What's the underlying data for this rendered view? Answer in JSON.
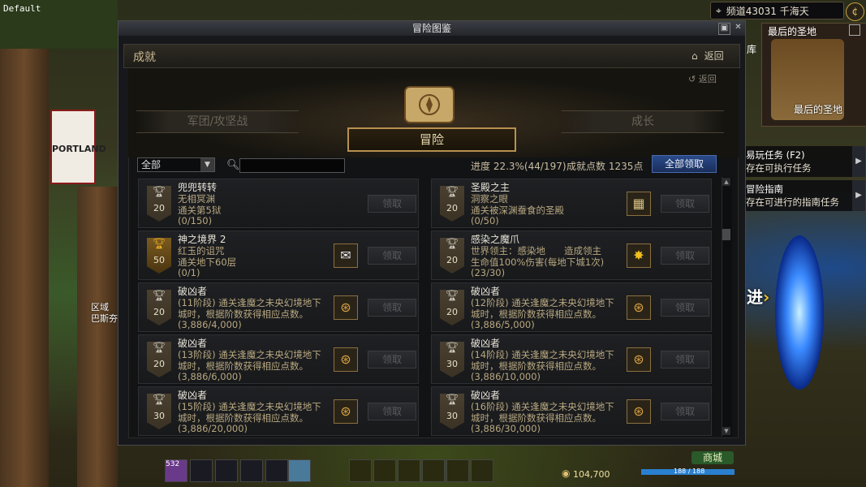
{
  "hud_top": {
    "default_label": "Default",
    "channel": "频道43031 千海天",
    "coin_icon": "coin-icon"
  },
  "minimap": {
    "title": "最后的圣地",
    "label": "最后的圣地"
  },
  "quests": [
    {
      "title": "易玩任务 (F2)",
      "subtitle": "存在可执行任务"
    },
    {
      "title": "冒险指南",
      "subtitle": "存在可进行的指南任务"
    }
  ],
  "world": {
    "portal_text": "进",
    "npc_line1": "区域",
    "npc_line2": "巴斯夯",
    "portland_sign": "PORTLAND",
    "sign_partial": "库"
  },
  "window": {
    "title": "冒险图鉴",
    "header_title": "成就",
    "back_label": "返回",
    "back_small": "返回",
    "categories": {
      "left": "军团/攻坚战",
      "center": "冒险",
      "right": "成长"
    },
    "filter": {
      "selected": "全部"
    },
    "search": {
      "placeholder": ""
    },
    "progress_text": "进度 22.3%(44/197)",
    "points_text": "成就点数 1235点",
    "claim_all_label": "全部领取",
    "claim_label": "领取"
  },
  "achievements": [
    {
      "name": "兜兜转转",
      "lines": [
        "无相冥渊",
        "通关第5狱"
      ],
      "progress": "(0/150)",
      "points": "20",
      "gold": false,
      "icon": ""
    },
    {
      "name": "圣殿之主",
      "lines": [
        "洞察之眼",
        "通关被深渊蚕食的圣殿"
      ],
      "progress": "(0/50)",
      "points": "20",
      "gold": false,
      "icon": "map-icon"
    },
    {
      "name": "神之境界 2",
      "lines": [
        "红玉的诅咒",
        "通关地下60层"
      ],
      "progress": "(0/1)",
      "points": "50",
      "gold": true,
      "icon": "scroll-note-icon"
    },
    {
      "name": "感染之魔爪",
      "lines": [
        "世界领主：感染地　　造成领主",
        "生命值100%伤害(每地下城1次)"
      ],
      "progress": "(23/30)",
      "points": "20",
      "gold": false,
      "icon": "burst-icon"
    },
    {
      "name": "破凶者",
      "lines": [
        "(11阶段) 通关逢魔之未央幻境地下",
        "城时，根据阶数获得相应点数。"
      ],
      "progress": "(3,886/4,000)",
      "points": "20",
      "gold": false,
      "icon": "emblem-icon"
    },
    {
      "name": "破凶者",
      "lines": [
        "(12阶段) 通关逢魔之未央幻境地下",
        "城时，根据阶数获得相应点数。"
      ],
      "progress": "(3,886/5,000)",
      "points": "20",
      "gold": false,
      "icon": "emblem-icon"
    },
    {
      "name": "破凶者",
      "lines": [
        "(13阶段) 通关逢魔之未央幻境地下",
        "城时，根据阶数获得相应点数。"
      ],
      "progress": "(3,886/6,000)",
      "points": "20",
      "gold": false,
      "icon": "emblem-icon"
    },
    {
      "name": "破凶者",
      "lines": [
        "(14阶段) 通关逢魔之未央幻境地下",
        "城时，根据阶数获得相应点数。"
      ],
      "progress": "(3,886/10,000)",
      "points": "30",
      "gold": false,
      "icon": "emblem-icon"
    },
    {
      "name": "破凶者",
      "lines": [
        "(15阶段) 通关逢魔之未央幻境地下",
        "城时，根据阶数获得相应点数。"
      ],
      "progress": "(3,886/20,000)",
      "points": "30",
      "gold": false,
      "icon": "emblem-icon"
    },
    {
      "name": "破凶者",
      "lines": [
        "(16阶段) 通关逢魔之未央幻境地下",
        "城时，根据阶数获得相应点数。"
      ],
      "progress": "(3,886/30,000)",
      "points": "30",
      "gold": false,
      "icon": "emblem-icon"
    }
  ],
  "hud_bottom": {
    "gold_amount": "104,700",
    "shop_label": "商城",
    "mp_text": "188 / 188",
    "skill_count": "532"
  }
}
